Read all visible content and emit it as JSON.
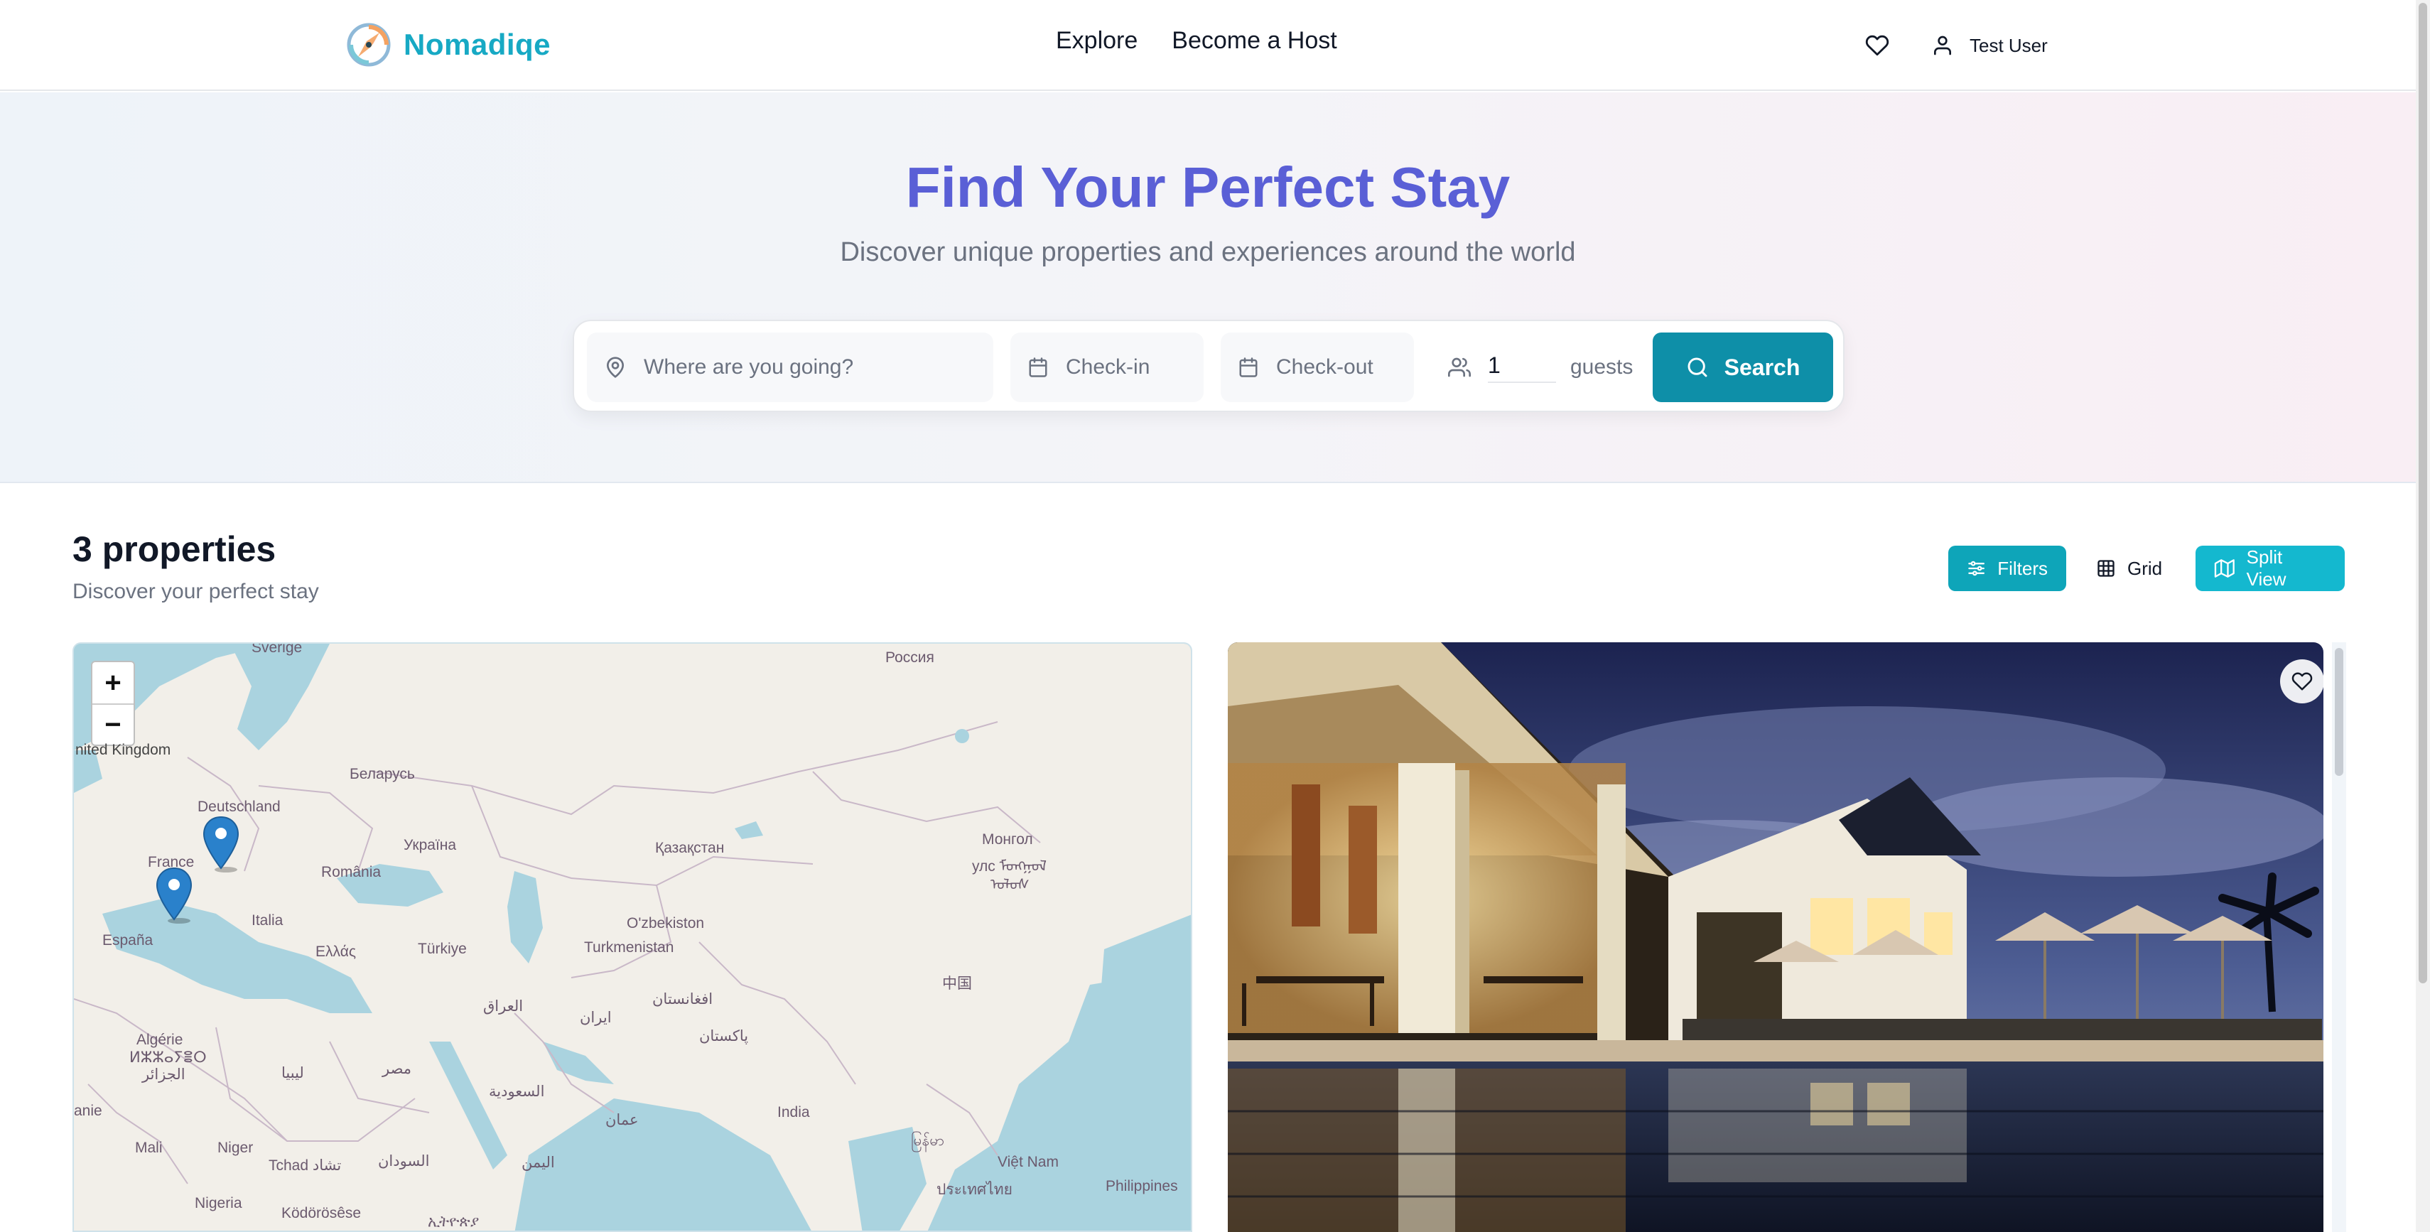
{
  "header": {
    "brand": "Nomadiqe",
    "nav": [
      {
        "label": "Explore"
      },
      {
        "label": "Become a Host"
      }
    ],
    "user_name": "Test User",
    "favorites_icon": "heart-icon",
    "user_icon": "user-icon"
  },
  "hero": {
    "title": "Find Your Perfect Stay",
    "subtitle": "Discover unique properties and experiences around the world"
  },
  "search": {
    "where_placeholder": "Where are you going?",
    "checkin_placeholder": "Check-in",
    "checkout_placeholder": "Check-out",
    "guests_value": "1",
    "guests_label": "guests",
    "button_label": "Search"
  },
  "results": {
    "title": "3 properties",
    "subtitle": "Discover your perfect stay"
  },
  "toolbar": {
    "filters_label": "Filters",
    "grid_label": "Grid",
    "split_label": "Split View"
  },
  "map": {
    "zoom_in": "+",
    "zoom_out": "−",
    "labels": {
      "sverige": "Sverige",
      "rossiya": "Россия",
      "uk": "nited Kingdom",
      "belarus": "Беларусь",
      "deutschland": "Deutschland",
      "ukraina": "Україна",
      "kazakhstan": "Қазақстан",
      "mongol": "Монгол",
      "mongol2": "улс ᠮᠣᠩᠭᠣᠯ",
      "mongol3": "ᠤᠯᠤᠰ",
      "france": "France",
      "romania": "România",
      "uzbekistan": "O'zbekiston",
      "espana": "España",
      "italia": "Italia",
      "turkmenistan": "Turkmenistan",
      "ellas": "Ελλάς",
      "turkiye": "Türkiye",
      "china": "中国",
      "afghanistan": "افغانستان",
      "iraq": "العراق",
      "iran": "ایران",
      "pakistan": "پاکستان",
      "algerie": "Algérie",
      "algerie2": "ⵍⵣⵣⴰⵢⴻⵔ",
      "algerie3": "الجزائر",
      "libya": "ليبيا",
      "misr": "مصر",
      "saudi": "السعودية",
      "oman": "عمان",
      "india": "India",
      "myanmar": "မြန်မာ",
      "thailand": "ประเทศไทย",
      "vietnam": "Việt Nam",
      "philippines": "Philippines",
      "mauritanie": "anie",
      "mali": "Mali",
      "niger": "Niger",
      "tchad": "Tchad تشاد",
      "sudan": "السودان",
      "yemen": "اليمن",
      "nigeria": "Nigeria",
      "kodorose": "Ködörösêse",
      "ethiopia": "ኢትዮጵያ"
    }
  },
  "card": {
    "favorite_icon": "heart-icon"
  }
}
